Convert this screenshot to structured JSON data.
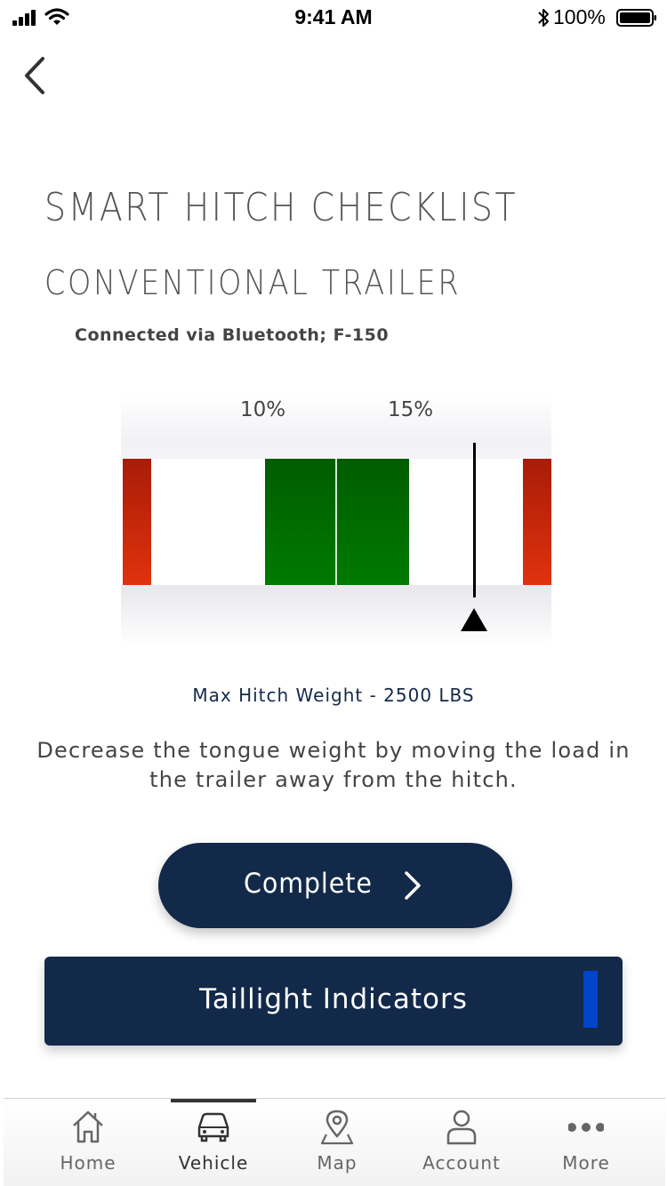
{
  "status_bar": {
    "time": "9:41 AM",
    "battery": "100%"
  },
  "header": {
    "title": "SMART HITCH CHECKLIST",
    "subtitle": "CONVENTIONAL TRAILER",
    "connection": "Connected via Bluetooth; F-150"
  },
  "gauge": {
    "labels": [
      "10%",
      "15%"
    ],
    "needle_level": 0.82
  },
  "max_weight": "Max Hitch Weight - 2500 LBS",
  "instruction": "Decrease the tongue weight by moving the load in the trailer away from the hitch.",
  "buttons": {
    "complete": "Complete",
    "taillight": "Taillight Indicators"
  },
  "tabs": [
    {
      "label": "Home",
      "icon": "home-icon"
    },
    {
      "label": "Vehicle",
      "icon": "car-icon",
      "active": true
    },
    {
      "label": "Map",
      "icon": "map-pin-icon"
    },
    {
      "label": "Account",
      "icon": "person-icon"
    },
    {
      "label": "More",
      "icon": "more-icon"
    }
  ],
  "colors": {
    "navy": "#12294a",
    "zone_red": "#d22a0c",
    "zone_green": "#006b00",
    "indicator_blue": "#0044cc"
  }
}
